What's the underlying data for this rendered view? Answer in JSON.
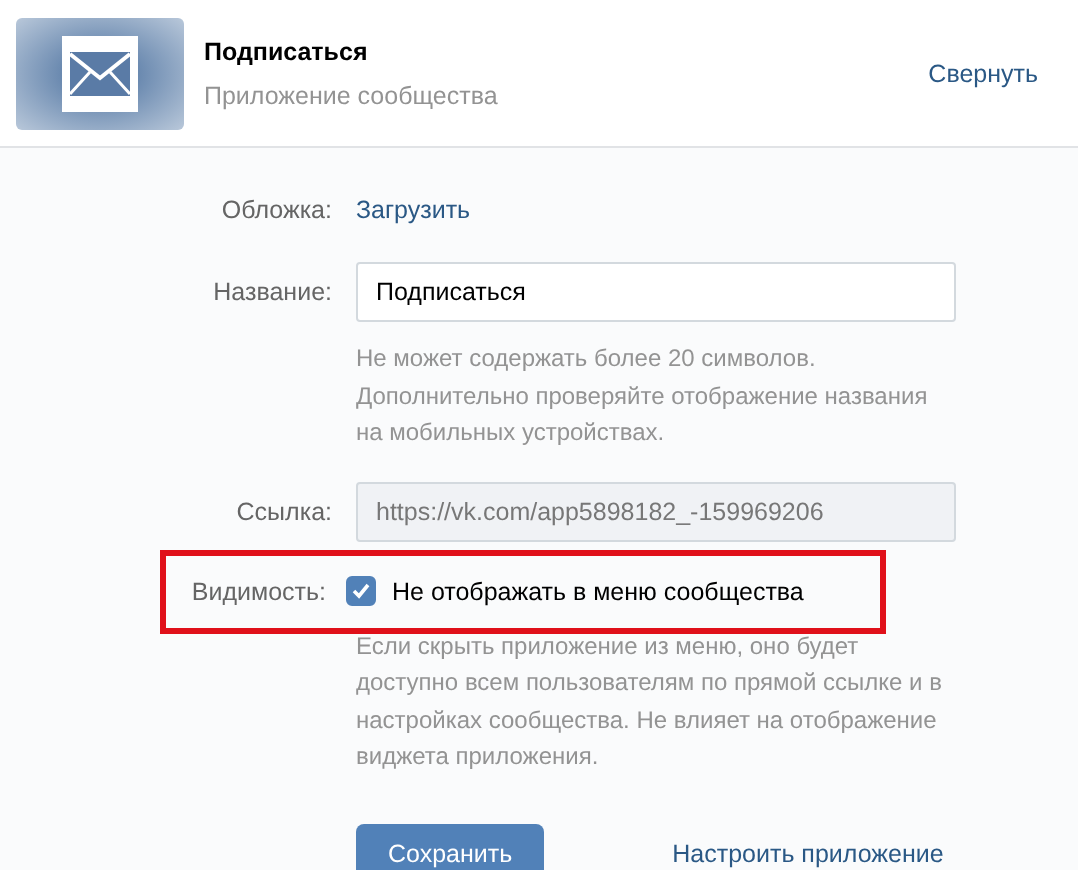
{
  "header": {
    "title": "Подписаться",
    "subtitle": "Приложение сообщества",
    "collapse_link": "Свернуть"
  },
  "form": {
    "cover": {
      "label": "Обложка:",
      "link": "Загрузить"
    },
    "name": {
      "label": "Название:",
      "value": "Подписаться",
      "hint": "Не может содержать более 20 символов. Дополнительно проверяйте отображение названия на мобильных устройствах."
    },
    "link": {
      "label": "Ссылка:",
      "value": "https://vk.com/app5898182_-159969206",
      "disabled": true
    },
    "visibility": {
      "label": "Видимость:",
      "checkbox_label": "Не отображать в меню сообщества",
      "checked": true,
      "highlighted": true,
      "hint": "Если скрыть приложение из меню, оно будет доступно всем пользователям по прямой ссылке и в настройках сообщества. Не влияет на отображение виджета приложения."
    }
  },
  "actions": {
    "save_button": "Сохранить",
    "settings_link": "Настроить приложение"
  }
}
